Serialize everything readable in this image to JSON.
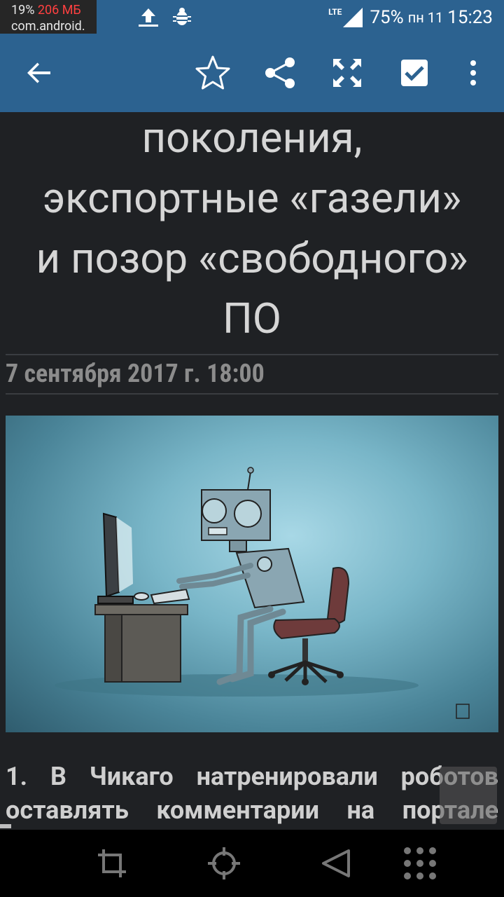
{
  "status_bar": {
    "cpu": "19%",
    "memory": "206 МБ",
    "package": "com.android.",
    "network": "LTE",
    "battery": "75%",
    "day": "пн 11",
    "time": "15:23",
    "icons": [
      "upload-icon",
      "bug-icon",
      "signal-icon"
    ]
  },
  "toolbar": {
    "icons": [
      "back-arrow-icon",
      "star-icon",
      "share-icon",
      "fullscreen-icon",
      "checkbox-icon",
      "more-vert-icon"
    ]
  },
  "article": {
    "title_lines": [
      "поколения,",
      "экспортные «газели»",
      "и позор «свободного»",
      "ПО"
    ],
    "date": "7 сентября 2017 г. 18:00",
    "paragraph_lines": [
      "1. В Чикаго натренировали роботов",
      "оставлять комментарии на портале"
    ]
  },
  "navbar": {
    "icons": [
      "crop-icon",
      "target-icon",
      "back-triangle-icon",
      "grid-dots-icon"
    ]
  },
  "colors": {
    "accent": "#2c6290",
    "background": "#1f2124",
    "memory_red": "#ff4040"
  }
}
